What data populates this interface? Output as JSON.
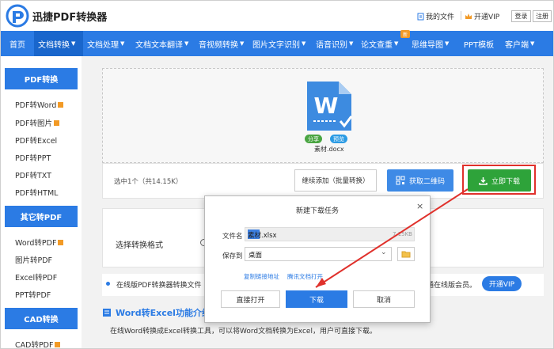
{
  "header": {
    "brand": "迅捷PDF转换器",
    "my_files": "我的文件",
    "open_vip": "开通VIP",
    "login": "登录",
    "register": "注册"
  },
  "nav": {
    "items": [
      "首页",
      "文档转换",
      "文档处理",
      "文档文本翻译",
      "音视频转换",
      "图片文字识别",
      "语音识别",
      "论文查重",
      "思维导图",
      "PPT模板",
      "客户端"
    ],
    "new_badge": "新"
  },
  "sidebar": {
    "sections": [
      {
        "title": "PDF转换",
        "items": [
          "PDF转Word",
          "PDF转图片",
          "PDF转Excel",
          "PDF转PPT",
          "PDF转TXT",
          "PDF转HTML"
        ]
      },
      {
        "title": "其它转PDF",
        "items": [
          "Word转PDF",
          "图片转PDF",
          "Excel转PDF",
          "PPT转PDF"
        ]
      },
      {
        "title": "CAD转换",
        "items": [
          "CAD转PDF"
        ]
      }
    ]
  },
  "upload": {
    "share": "分享",
    "preview": "预览",
    "file_name": "素材.docx",
    "file_letter": "W"
  },
  "actions": {
    "selected": "选中1个（共14.15K）",
    "continue_add": "继续添加（批量转换）",
    "get_qr": "获取二维码",
    "download_now": "立即下载"
  },
  "format": {
    "label": "选择转换格式"
  },
  "notice": {
    "left": "在线版PDF转换器转换文件",
    "right": "通在线版会员。",
    "vip_button": "开通VIP"
  },
  "section": {
    "title": "Word转Excel功能介绍",
    "text": "在线Word转换成Excel转换工具，可以将Word文档转换为Excel，用户可直接下载。"
  },
  "dialog": {
    "title": "新建下载任务",
    "close": "×",
    "file_name_label": "文件名",
    "file_name_value": "素材.xlsx",
    "file_size": "7.15KB",
    "save_to_label": "保存到",
    "save_to_value": "桌面",
    "copy_link": "复制链接地址",
    "tencent_open": "腾讯文档打开",
    "open_direct": "直接打开",
    "download": "下载",
    "cancel": "取消"
  },
  "colors": {
    "brand_blue": "#2b7be4",
    "download_green": "#2ea33a",
    "highlight_red": "#e0312c",
    "badge_orange": "#f29a26"
  }
}
